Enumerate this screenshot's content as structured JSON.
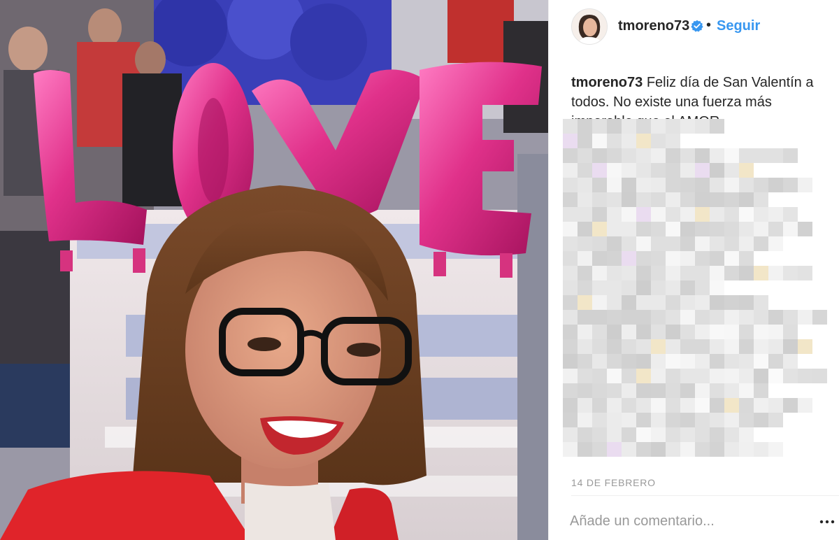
{
  "post": {
    "username": "tmoreno73",
    "separator": "•",
    "follow_label": "Seguir",
    "caption_user": "tmoreno73",
    "caption_text": "Feliz día de San Valentín a todos. No existe una fuerza más imparable que el AMOR.",
    "date": "14 DE FEBRERO",
    "comment_placeholder": "Añade un comentario..."
  },
  "photo": {
    "balloon_text": "LOVE",
    "description": ""
  },
  "colors": {
    "link": "#3897f0",
    "text": "#262626",
    "muted": "#999999",
    "balloon": "#e0318a"
  },
  "icons": {
    "verified": "verified-badge-icon",
    "more": "more-options-icon"
  }
}
